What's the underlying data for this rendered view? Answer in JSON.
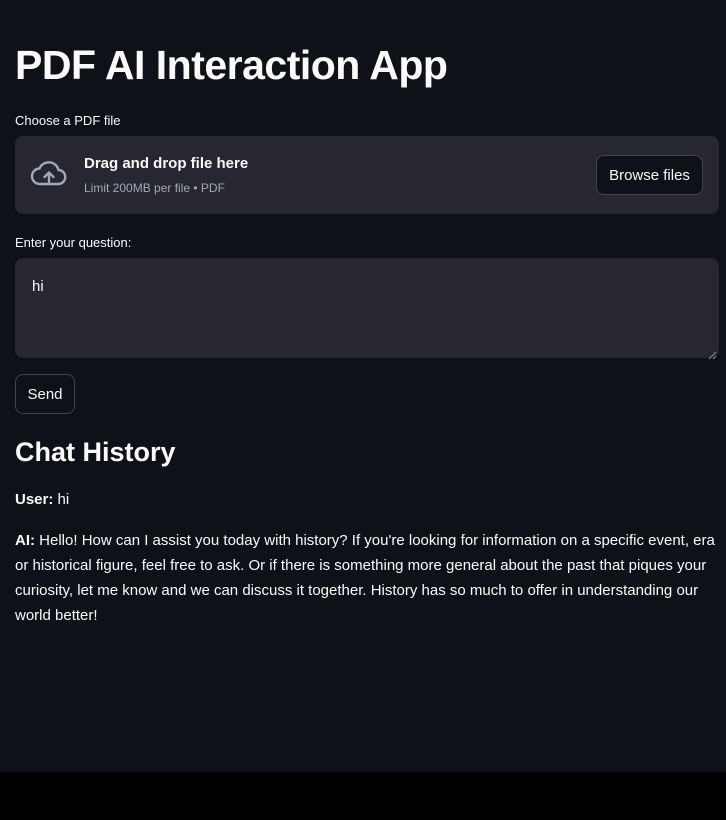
{
  "page": {
    "title": "PDF AI Interaction App"
  },
  "uploader": {
    "label": "Choose a PDF file",
    "drop_text": "Drag and drop file here",
    "limit_text": "Limit 200MB per file • PDF",
    "browse_label": "Browse files",
    "icon": "cloud-upload-icon"
  },
  "question": {
    "label": "Enter your question:",
    "value": "hi"
  },
  "send": {
    "label": "Send"
  },
  "chat": {
    "title": "Chat History",
    "messages": [
      {
        "role": "User:",
        "text": "hi"
      },
      {
        "role": "AI:",
        "text": "Hello! How can I assist you today with history? If you're looking for information on a specific event, era or historical figure, feel free to ask. Or if there is something more general about the past that piques your curiosity, let me know and we can discuss it together. History has so much to offer in understanding our world better!"
      }
    ]
  },
  "colors": {
    "background": "#0e1117",
    "widget": "#262730",
    "text": "#fafafa",
    "muted": "#a3a8b8"
  }
}
